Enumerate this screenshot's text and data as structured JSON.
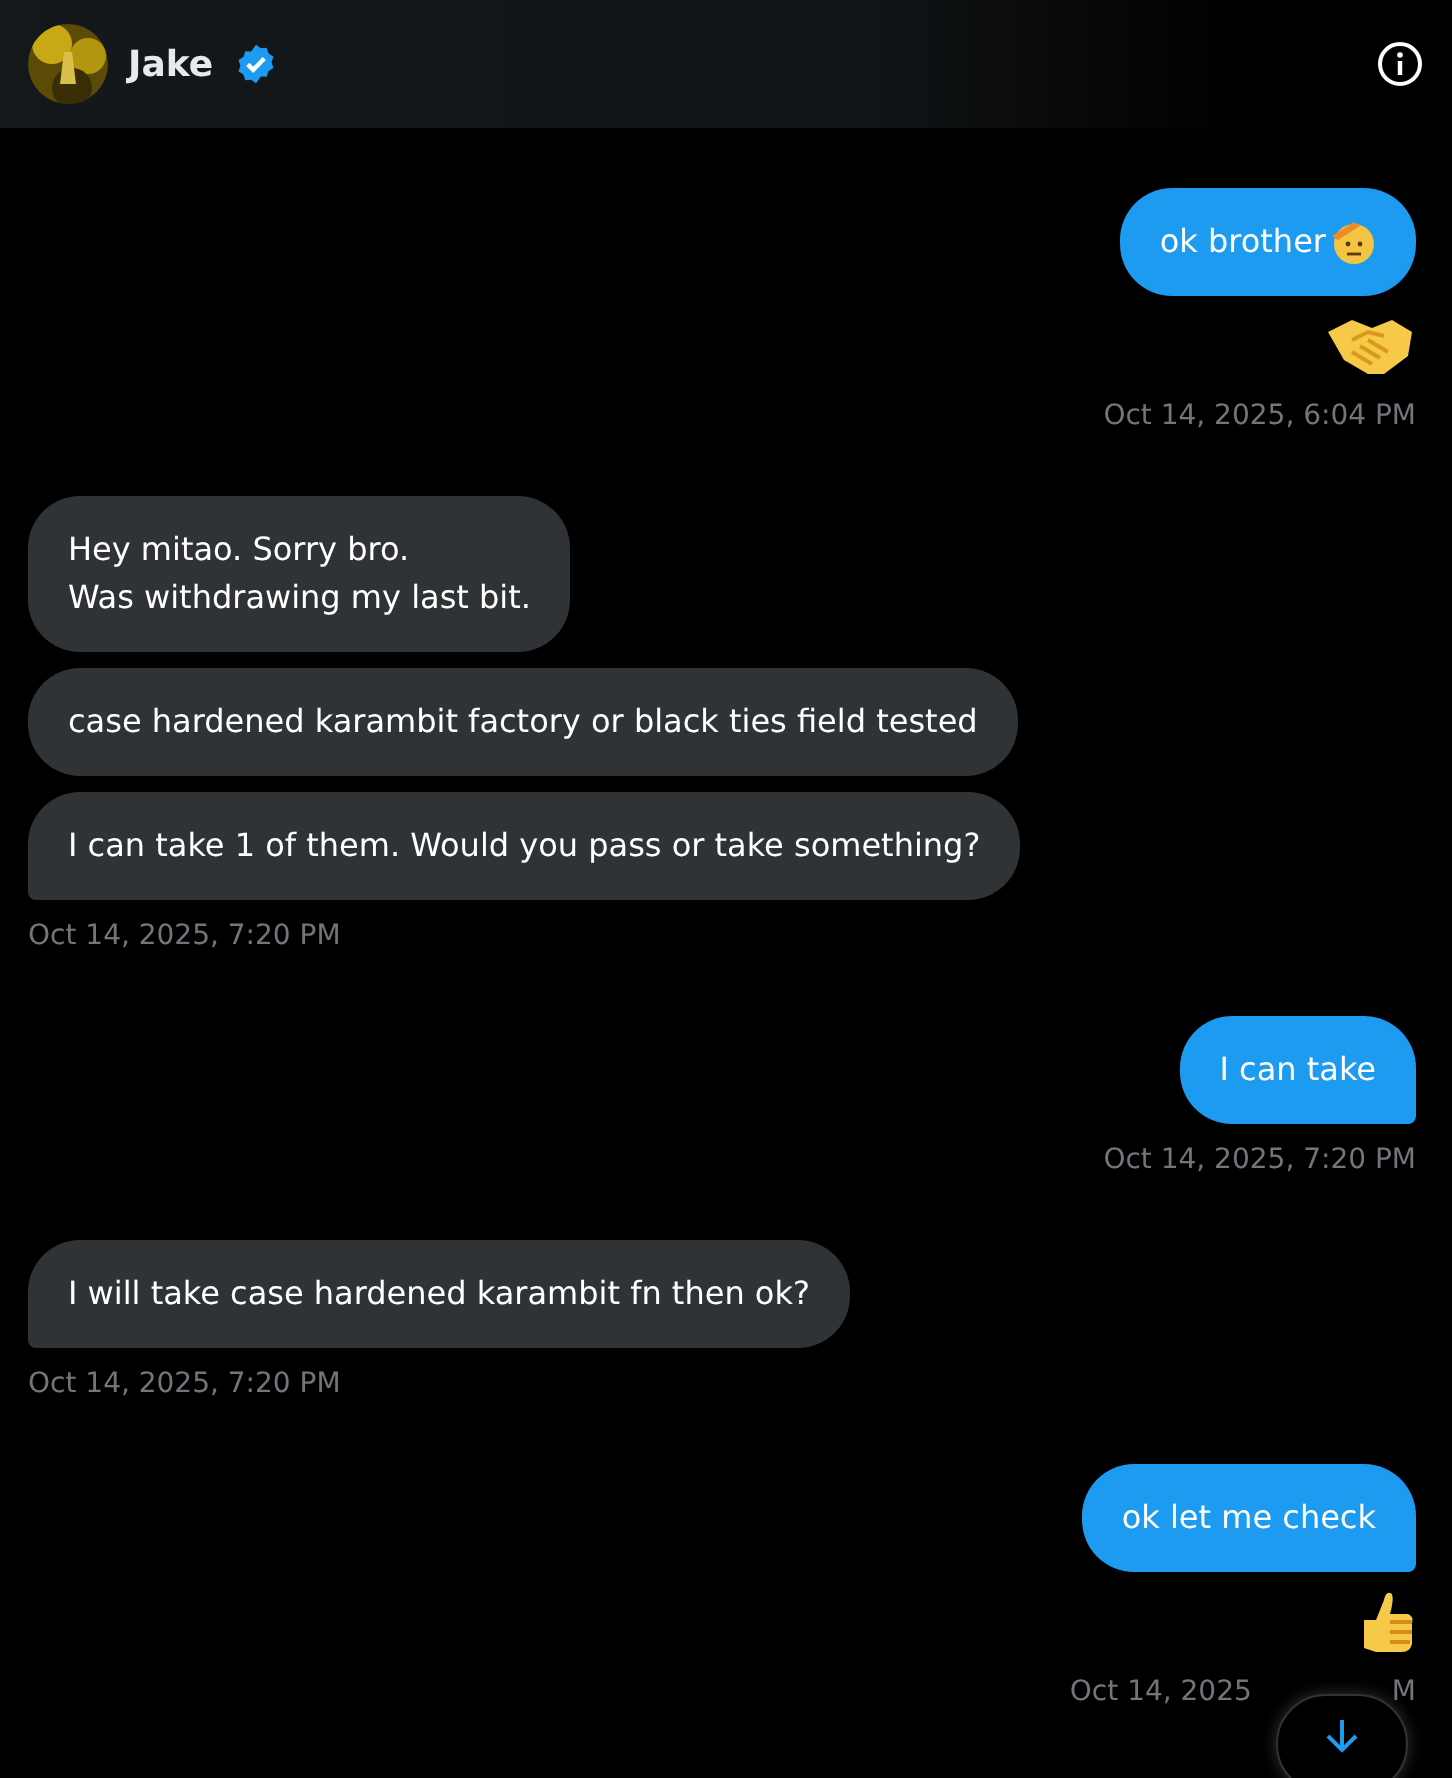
{
  "header": {
    "name": "Jake",
    "verified": true
  },
  "groups": [
    {
      "kind": "sent",
      "messages": [
        {
          "kind": "text_salute",
          "text": "ok brother",
          "tail": false
        },
        {
          "kind": "handshake"
        }
      ],
      "timestamp": "Oct 14, 2025, 6:04 PM"
    },
    {
      "kind": "received",
      "messages": [
        {
          "kind": "text",
          "text": "Hey mitao. Sorry bro.\nWas withdrawing my last bit.",
          "tail": false
        },
        {
          "kind": "text",
          "text": "case hardened karambit factory or black ties field tested",
          "tail": false
        },
        {
          "kind": "text",
          "text": "I can take 1 of them. Would you pass or take something?",
          "tail": true
        }
      ],
      "timestamp": "Oct 14, 2025, 7:20 PM"
    },
    {
      "kind": "sent",
      "messages": [
        {
          "kind": "text",
          "text": "I can take",
          "tail": true
        }
      ],
      "timestamp": "Oct 14, 2025, 7:20 PM"
    },
    {
      "kind": "received",
      "messages": [
        {
          "kind": "text",
          "text": "I will take case hardened karambit fn then ok?",
          "tail": true
        }
      ],
      "timestamp": "Oct 14, 2025, 7:20 PM"
    },
    {
      "kind": "sent",
      "messages": [
        {
          "kind": "text",
          "text": "ok let me check",
          "tail": true
        },
        {
          "kind": "thumbs_up"
        }
      ],
      "timestamp_parts": [
        "Oct 14, 2025",
        "M"
      ]
    }
  ]
}
